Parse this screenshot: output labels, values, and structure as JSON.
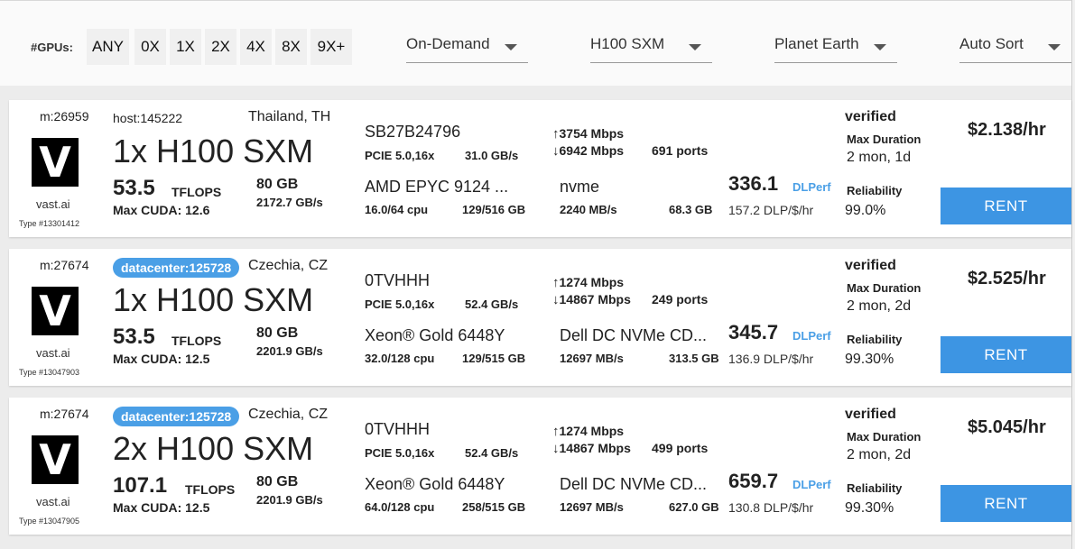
{
  "filters": {
    "gpus_label": "#GPUs:",
    "gpu_counts": [
      "ANY",
      "0X",
      "1X",
      "2X",
      "4X",
      "8X",
      "9X+"
    ],
    "pricing": "On-Demand",
    "gpu_model": "H100 SXM",
    "region": "Planet Earth",
    "sort": "Auto Sort"
  },
  "colors": {
    "accent": "#3d95e3",
    "badge": "#4a9fe6",
    "logo_bg": "#000000"
  },
  "listings": [
    {
      "machine_id": "m:26959",
      "logo_letter": "V",
      "brand": "vast.ai",
      "type_id": "Type #13301412",
      "host": "host:145222",
      "host_is_badge": false,
      "location": "Thailand, TH",
      "gpu_name": "1x H100 SXM",
      "tflops": "53.5",
      "tflops_label": "TFLOPS",
      "cuda": "Max CUDA: 12.6",
      "vram": "80 GB",
      "vram_bw": "2172.7 GB/s",
      "mobo": "SB27B24796",
      "pcie": "PCIE 5.0,16x",
      "pcie_bw": "31.0 GB/s",
      "cpu": "AMD EPYC 9124 ...",
      "cpu_cores": "16.0/64 cpu",
      "ram": "129/516 GB",
      "upload": "3754 Mbps",
      "download": "6942 Mbps",
      "ports": "691 ports",
      "disk": "nvme",
      "disk_bw": "2240 MB/s",
      "disk_size": "68.3 GB",
      "dlperf": "336.1",
      "dlperf_label": "DLPerf",
      "dlp_price": "157.2 DLP/$/hr",
      "verified": "verified",
      "max_duration_label": "Max Duration",
      "max_duration": "2 mon, 1d",
      "reliability_label": "Reliability",
      "reliability": "99.0%",
      "price": "$2.138/hr",
      "rent_label": "RENT"
    },
    {
      "machine_id": "m:27674",
      "logo_letter": "V",
      "brand": "vast.ai",
      "type_id": "Type #13047903",
      "host": "datacenter:125728",
      "host_is_badge": true,
      "location": "Czechia, CZ",
      "gpu_name": "1x H100 SXM",
      "tflops": "53.5",
      "tflops_label": "TFLOPS",
      "cuda": "Max CUDA: 12.5",
      "vram": "80 GB",
      "vram_bw": "2201.9 GB/s",
      "mobo": "0TVHHH",
      "pcie": "PCIE 5.0,16x",
      "pcie_bw": "52.4 GB/s",
      "cpu": "Xeon® Gold 6448Y",
      "cpu_cores": "32.0/128 cpu",
      "ram": "129/515 GB",
      "upload": "1274 Mbps",
      "download": "14867 Mbps",
      "ports": "249 ports",
      "disk": "Dell DC NVMe CD...",
      "disk_bw": "12697 MB/s",
      "disk_size": "313.5 GB",
      "dlperf": "345.7",
      "dlperf_label": "DLPerf",
      "dlp_price": "136.9 DLP/$/hr",
      "verified": "verified",
      "max_duration_label": "Max Duration",
      "max_duration": "2 mon, 2d",
      "reliability_label": "Reliability",
      "reliability": "99.30%",
      "price": "$2.525/hr",
      "rent_label": "RENT"
    },
    {
      "machine_id": "m:27674",
      "logo_letter": "V",
      "brand": "vast.ai",
      "type_id": "Type #13047905",
      "host": "datacenter:125728",
      "host_is_badge": true,
      "location": "Czechia, CZ",
      "gpu_name": "2x H100 SXM",
      "tflops": "107.1",
      "tflops_label": "TFLOPS",
      "cuda": "Max CUDA: 12.5",
      "vram": "80 GB",
      "vram_bw": "2201.9 GB/s",
      "mobo": "0TVHHH",
      "pcie": "PCIE 5.0,16x",
      "pcie_bw": "52.4 GB/s",
      "cpu": "Xeon® Gold 6448Y",
      "cpu_cores": "64.0/128 cpu",
      "ram": "258/515 GB",
      "upload": "1274 Mbps",
      "download": "14867 Mbps",
      "ports": "499 ports",
      "disk": "Dell DC NVMe CD...",
      "disk_bw": "12697 MB/s",
      "disk_size": "627.0 GB",
      "dlperf": "659.7",
      "dlperf_label": "DLPerf",
      "dlp_price": "130.8 DLP/$/hr",
      "verified": "verified",
      "max_duration_label": "Max Duration",
      "max_duration": "2 mon, 2d",
      "reliability_label": "Reliability",
      "reliability": "99.30%",
      "price": "$5.045/hr",
      "rent_label": "RENT"
    }
  ]
}
